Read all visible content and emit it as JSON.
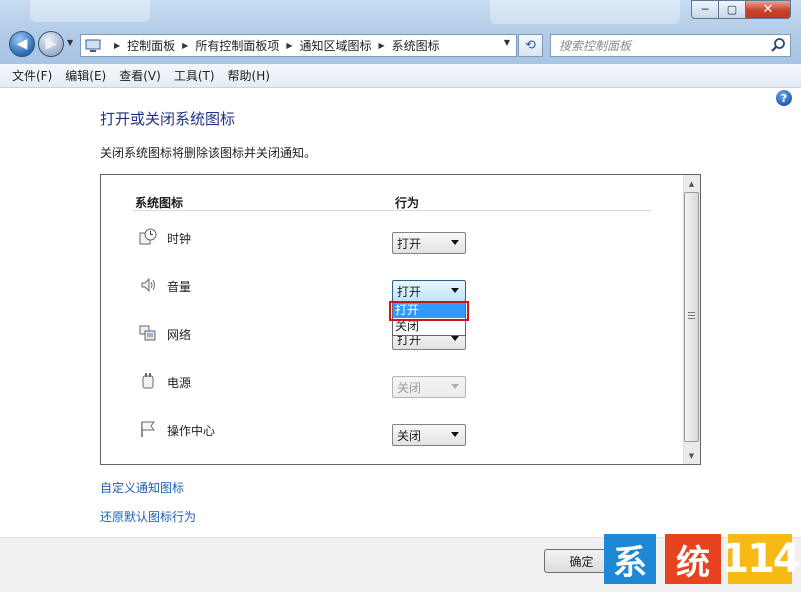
{
  "window": {
    "minimize_glyph": "─",
    "maximize_glyph": "▢",
    "close_glyph": "✕"
  },
  "nav": {
    "back_glyph": "◀",
    "forward_glyph": "▶",
    "dropdown_glyph": "▼",
    "refresh_glyph": "⟲"
  },
  "address": {
    "crumbs": [
      "控制面板",
      "所有控制面板项",
      "通知区域图标",
      "系统图标"
    ],
    "separator": "▶"
  },
  "search": {
    "placeholder": "搜索控制面板"
  },
  "menu": [
    "文件(F)",
    "编辑(E)",
    "查看(V)",
    "工具(T)",
    "帮助(H)"
  ],
  "help_glyph": "?",
  "page": {
    "title": "打开或关闭系统图标",
    "description": "关闭系统图标将删除该图标并关闭通知。"
  },
  "table": {
    "col_icons": "系统图标",
    "col_behavior": "行为",
    "rows": [
      {
        "label": "时钟",
        "icon": "clock-icon",
        "value": "打开",
        "state": "normal"
      },
      {
        "label": "音量",
        "icon": "speaker-icon",
        "value": "打开",
        "state": "open"
      },
      {
        "label": "网络",
        "icon": "network-icon",
        "value": "打开",
        "state": "normal"
      },
      {
        "label": "电源",
        "icon": "power-icon",
        "value": "关闭",
        "state": "disabled"
      },
      {
        "label": "操作中心",
        "icon": "flag-icon",
        "value": "关闭",
        "state": "normal"
      }
    ]
  },
  "dropdown": {
    "options": [
      "打开",
      "关闭"
    ],
    "selected": "打开"
  },
  "scroll": {
    "up_glyph": "▲",
    "down_glyph": "▼"
  },
  "links": {
    "customize": "自定义通知图标",
    "restore": "还原默认图标行为"
  },
  "footer": {
    "ok": "确定"
  },
  "watermark": [
    "系",
    "统",
    "114"
  ],
  "colors": {
    "title": "#1e3287",
    "link": "#1e5fb4",
    "highlight": "#c8161e",
    "selection": "#3399ff"
  }
}
